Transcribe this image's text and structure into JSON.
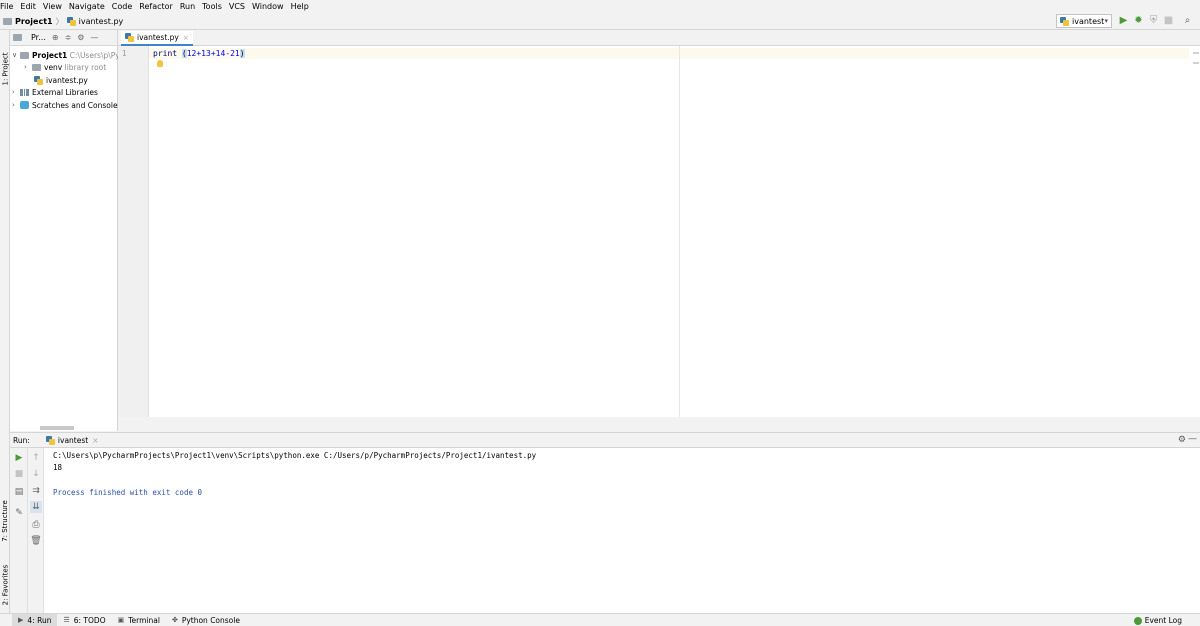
{
  "menu": [
    "File",
    "Edit",
    "View",
    "Navigate",
    "Code",
    "Refactor",
    "Run",
    "Tools",
    "VCS",
    "Window",
    "Help"
  ],
  "navbar": {
    "project": "Project1",
    "file": "ivantest.py"
  },
  "run_config": {
    "name": "ivantest"
  },
  "toolbar_icons": [
    "run-icon",
    "debug-icon",
    "coverage-icon",
    "stop-icon",
    "search-icon"
  ],
  "left_stripe": {
    "project_tab": "1: Project",
    "structure_tab": "7: Structure",
    "favorites_tab": "2: Favorites"
  },
  "project_panel": {
    "title": "Pr...",
    "tree": [
      {
        "label": "Project1",
        "hint": "C:\\Users\\p\\Pyc"
      },
      {
        "label": "venv",
        "hint": "library root"
      },
      {
        "label": "ivantest.py",
        "hint": ""
      },
      {
        "label": "External Libraries",
        "hint": ""
      },
      {
        "label": "Scratches and Consoles",
        "hint": ""
      }
    ]
  },
  "editor": {
    "tab": "ivantest.py",
    "line_number": "1",
    "code": {
      "keyword": "print ",
      "open": "(",
      "expr": "12+13+14-21",
      "close": ")"
    }
  },
  "run_panel": {
    "title": "Run:",
    "tab": "ivantest",
    "console": {
      "command": "C:\\Users\\p\\PycharmProjects\\Project1\\venv\\Scripts\\python.exe C:/Users/p/PycharmProjects/Project1/ivantest.py",
      "output": "18",
      "exit": "Process finished with exit code 0"
    }
  },
  "bottom_tabs": [
    "4: Run",
    "6: TODO",
    "Terminal",
    "Python Console"
  ],
  "event_log": "Event Log",
  "colors": {
    "accent": "#4083c9",
    "run_green": "#4b9a3a",
    "exit_blue": "#2a4fa3"
  }
}
